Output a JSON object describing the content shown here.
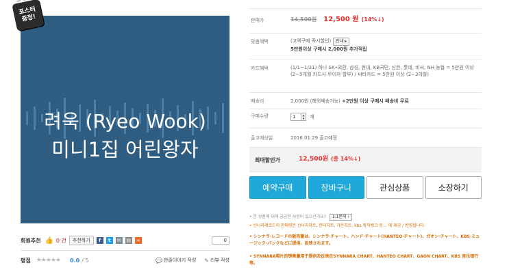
{
  "badge": {
    "line1": "포스터",
    "line2": "증정!"
  },
  "cover": {
    "line1": "려욱 (Ryeo Wook)",
    "line2": "미니1집 어린왕자"
  },
  "like": {
    "label": "회원추천",
    "count": "0 건",
    "recommend_btn": "추천하기",
    "count_box": "0"
  },
  "rating": {
    "label": "평점",
    "stars": "★★★★★",
    "score": "0.0",
    "max": "/ 5",
    "write_one_liner": "한줄이야기 작성",
    "write_review": "리뷰 작성"
  },
  "info": {
    "sale_label": "판매가",
    "list_price": "14,500원",
    "sale_price": "12,500 원",
    "discount": "(14%↓)",
    "benefit_label": "맞춤혜택",
    "benefit_line1": "(고액구매 즉시할인)",
    "guide_btn": "안내 ▸",
    "benefit_line2": "5만원이상 구매시 2,000원 추가적립",
    "card_label": "카드혜택",
    "card_text": "(1/1~1/31) 하나 SK•외환, 삼성, 현대, KB국민, 신한, 롯데, 비씨, NH 농협 = 5만원 이상 (2~5개월 카드사 무이자 할부) / 씨티카드 = 5만원 이상 (2~3개월)",
    "ship_label": "배송비",
    "ship_text": "2,000원 (해외배송가능)",
    "ship_bold": "+2만원 이상 구매시 배송비 무료",
    "qty_label": "구매수량",
    "qty_value": "1",
    "qty_unit": "개",
    "release_label": "출고예상일",
    "release_text": "2016.01.29 출고예정",
    "max_label": "최대할인가",
    "max_price": "12,500원",
    "max_pct": "(총 14%↓)"
  },
  "actions": {
    "preorder": "예약구매",
    "cart": "장바구니",
    "wish": "관심상품",
    "collect": "소장하기"
  },
  "notice": {
    "question": "• 본 상품에 대해 궁금한 사항이 있으신가요?",
    "question_btn": "1:1문의 ›",
    "line1": "• 신나라레코드의 판매량은 신나라차트, 한터차트, 가온차트, kbs 뮤직뱅크 등… 에 제공 / 반영됩니다.",
    "line2": "• シンナラ·レコードの販売量は、シンナラ·チャート、ハンド·チャート(HANTEO·チャート)、ガオン·チャート、KBS·ミュージック·バンクなどに提供、反映されます。",
    "line3": "• SYNNARA唱片的销售量用于提供及反映在SYNNARA CHART、HANTEO CHART、GAON CHART、KBS 音乐银行等。"
  },
  "colors": {
    "accent": "#1fa8d9",
    "price_red": "#e5302f",
    "cover_bg": "#2f5d82",
    "notice_orange": "#d86a00"
  }
}
